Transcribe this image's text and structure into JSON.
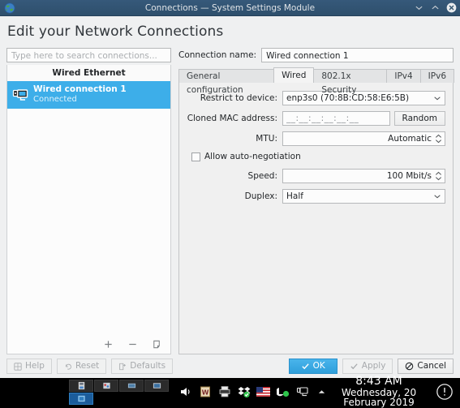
{
  "window": {
    "title": "Connections — System Settings Module",
    "app_icon": "globe-icon",
    "controls": {
      "minimize": "chevron-down-icon",
      "maximize": "chevron-up-icon",
      "close": "close-circle-icon"
    }
  },
  "header": {
    "title": "Edit your Network Connections"
  },
  "sidebar": {
    "search": {
      "placeholder": "Type here to search connections...",
      "value": ""
    },
    "group_label": "Wired Ethernet",
    "items": [
      {
        "name": "Wired connection 1",
        "status": "Connected",
        "icon": "wired-network-icon",
        "selected": true
      }
    ],
    "tools": [
      {
        "name": "add-connection-button",
        "icon": "plus-icon",
        "label": "+"
      },
      {
        "name": "remove-connection-button",
        "icon": "minus-icon",
        "label": "−"
      },
      {
        "name": "duplicate-connection-button",
        "icon": "duplicate-icon",
        "label": ""
      }
    ]
  },
  "form": {
    "connection_name": {
      "label": "Connection name:",
      "value": "Wired connection 1"
    },
    "tabs": [
      {
        "label": "General configuration",
        "active": false
      },
      {
        "label": "Wired",
        "active": true
      },
      {
        "label": "802.1x Security",
        "active": false
      },
      {
        "label": "IPv4",
        "active": false
      },
      {
        "label": "IPv6",
        "active": false
      }
    ],
    "fields": {
      "restrict_device": {
        "label": "Restrict to device:",
        "value": "enp3s0 (70:8B:CD:58:E6:5B)",
        "type": "combobox"
      },
      "cloned_mac": {
        "label": "Cloned MAC address:",
        "value": "__:__:__:__:__:__",
        "type": "masked-input",
        "button": "Random"
      },
      "mtu": {
        "label": "MTU:",
        "value": "Automatic",
        "type": "spinbox"
      },
      "auto_negotiation": {
        "label": "Allow auto-negotiation",
        "checked": false
      },
      "speed": {
        "label": "Speed:",
        "value": "100 Mbit/s",
        "type": "spinbox"
      },
      "duplex": {
        "label": "Duplex:",
        "value": "Half",
        "type": "combobox"
      }
    }
  },
  "footer": {
    "help": {
      "label": "Help",
      "icon": "help-icon",
      "enabled": false
    },
    "reset": {
      "label": "Reset",
      "icon": "undo-icon",
      "enabled": false
    },
    "defaults": {
      "label": "Defaults",
      "icon": "defaults-icon",
      "enabled": false
    },
    "ok": {
      "label": "OK",
      "icon": "check-icon",
      "enabled": true
    },
    "apply": {
      "label": "Apply",
      "icon": "check-icon",
      "enabled": false
    },
    "cancel": {
      "label": "Cancel",
      "icon": "cancel-icon",
      "enabled": true
    }
  },
  "taskbar": {
    "tray_icons": [
      "volume-icon",
      "wine-icon",
      "printer-icon",
      "dropbox-icon",
      "keyboard-layout-us-flag-icon",
      "kde-connect-icon",
      "network-monitor-icon",
      "show-hidden-tray-icon"
    ],
    "clock": {
      "time": "8:43 AM",
      "date": "Wednesday, 20 February 2019"
    },
    "notification_icon": "notification-exclamation-icon"
  },
  "colors": {
    "titlebar": "#31546f",
    "accent": "#3daee9",
    "window_bg": "#eff0f1",
    "panel_bg": "#f0f0f0",
    "taskbar_bg": "#000000"
  }
}
